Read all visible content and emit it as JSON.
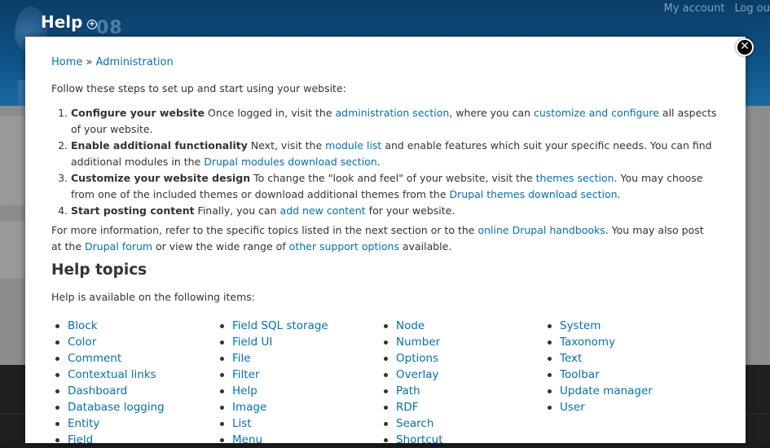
{
  "background": {
    "site_name": "08",
    "user_menu": [
      "My account",
      "Log ou"
    ]
  },
  "overlay": {
    "title": "Help",
    "shortcut_icon": "plus-circle-icon",
    "close_icon": "close-icon",
    "close_glyph": "✕"
  },
  "breadcrumb": {
    "home": "Home",
    "separator": " » ",
    "administration": "Administration"
  },
  "intro": "Follow these steps to set up and start using your website:",
  "steps": [
    {
      "title": "Configure your website",
      "parts": [
        " Once logged in, visit the ",
        "administration section",
        ", where you can ",
        "customize and configure",
        " all aspects of your website."
      ]
    },
    {
      "title": "Enable additional functionality",
      "parts": [
        " Next, visit the ",
        "module list",
        " and enable features which suit your specific needs. You can find additional modules in the ",
        "Drupal modules download section",
        "."
      ]
    },
    {
      "title": "Customize your website design",
      "parts": [
        " To change the \"look and feel\" of your website, visit the ",
        "themes section",
        ". You may choose from one of the included themes or download additional themes from the ",
        "Drupal themes download section",
        "."
      ]
    },
    {
      "title": "Start posting content",
      "parts": [
        " Finally, you can ",
        "add new content",
        " for your website."
      ]
    }
  ],
  "more_info": [
    "For more information, refer to the specific topics listed in the next section or to the ",
    "online Drupal handbooks",
    ". You may also post at the ",
    "Drupal forum",
    " or view the wide range of ",
    "other support options",
    " available."
  ],
  "help_topics": {
    "heading": "Help topics",
    "intro": "Help is available on the following items:",
    "columns": [
      [
        "Block",
        "Color",
        "Comment",
        "Contextual links",
        "Dashboard",
        "Database logging",
        "Entity",
        "Field"
      ],
      [
        "Field SQL storage",
        "Field UI",
        "File",
        "Filter",
        "Help",
        "Image",
        "List",
        "Menu"
      ],
      [
        "Node",
        "Number",
        "Options",
        "Overlay",
        "Path",
        "RDF",
        "Search",
        "Shortcut"
      ],
      [
        "System",
        "Taxonomy",
        "Text",
        "Toolbar",
        "Update manager",
        "User"
      ]
    ]
  }
}
